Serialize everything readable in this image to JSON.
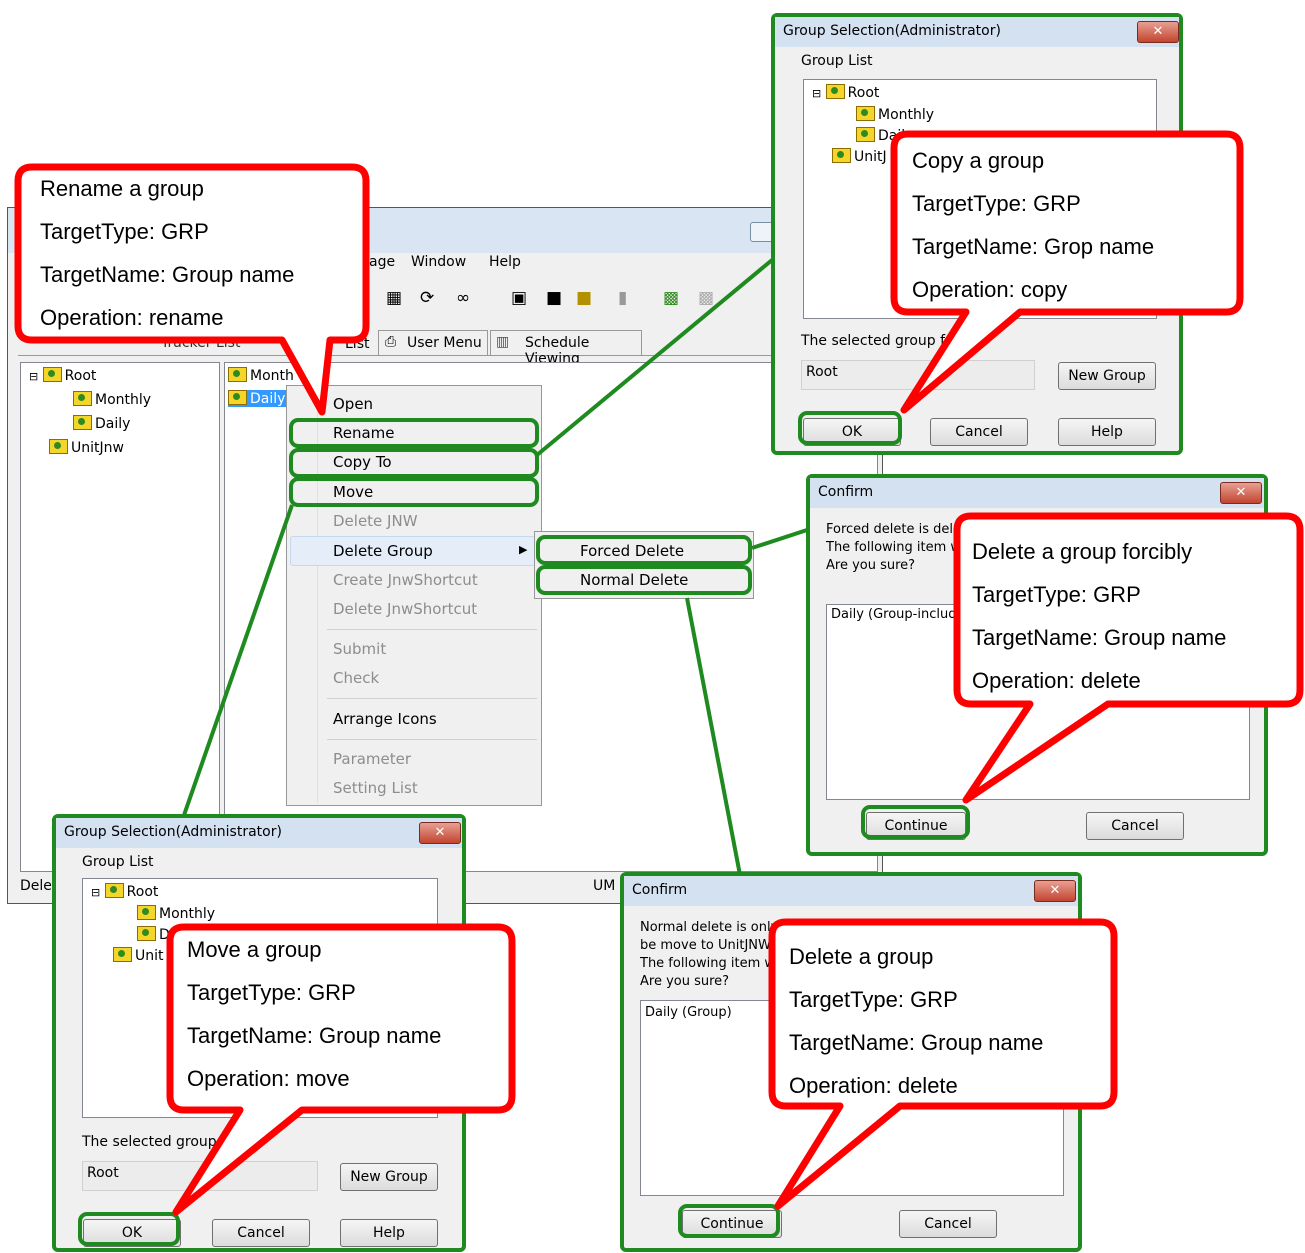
{
  "main_window": {
    "menubar": [
      "age",
      "Window",
      "Help"
    ],
    "tabs": [
      "Tracker List",
      "List",
      "User Menu",
      "Schedule Viewing"
    ],
    "tree": [
      "Root",
      "Monthly",
      "Daily",
      "UnitJnw"
    ],
    "list_items": [
      "Month",
      "Daily"
    ],
    "status_left": "Delet",
    "status_right": "UM"
  },
  "context_menu": {
    "items": [
      "Open",
      "Rename",
      "Copy To",
      "Move",
      "Delete JNW",
      "Delete Group",
      "Create JnwShortcut",
      "Delete JnwShortcut",
      "Submit",
      "Check",
      "Arrange Icons",
      "Parameter",
      "Setting List"
    ],
    "submenu": [
      "Forced Delete",
      "Normal Delete"
    ]
  },
  "group_dialog_top": {
    "title": "Group Selection(Administrator)",
    "close": "✕",
    "group_list_label": "Group List",
    "tree": [
      "Root",
      "Monthly",
      "Dail",
      "UnitJ"
    ],
    "selected_label": "The selected group ful",
    "selected_value": "Root",
    "new_group": "New Group",
    "ok": "OK",
    "cancel": "Cancel",
    "help": "Help"
  },
  "group_dialog_bottom": {
    "title": "Group Selection(Administrator)",
    "close": "✕",
    "group_list_label": "Group List",
    "tree": [
      "Root",
      "Monthly",
      "D",
      "Unit"
    ],
    "selected_label": "The selected group fu",
    "selected_value": "Root",
    "new_group": "New Group",
    "ok": "OK",
    "cancel": "Cancel",
    "help": "Help"
  },
  "confirm_forced": {
    "title": "Confirm",
    "close": "✕",
    "message": [
      "Forced delete is dele",
      "The following item w",
      "Are you sure?"
    ],
    "item": "Daily (Group-includi",
    "continue": "Continue",
    "cancel": "Cancel"
  },
  "confirm_normal": {
    "title": "Confirm",
    "close": "✕",
    "message": [
      "Normal delete is only",
      "be move to UnitJNW",
      "The following item w",
      "Are you sure?"
    ],
    "item": "Daily (Group)",
    "continue": "Continue",
    "cancel": "Cancel"
  },
  "callouts": {
    "rename": [
      "Rename a group",
      "TargetType: GRP",
      "TargetName: Group name",
      "Operation: rename"
    ],
    "copy": [
      "Copy a group",
      "TargetType: GRP",
      "TargetName: Grop name",
      "Operation: copy"
    ],
    "forced": [
      "Delete a group forcibly",
      "TargetType: GRP",
      "TargetName: Group name",
      "Operation: delete"
    ],
    "move": [
      "Move a group",
      "TargetType: GRP",
      "TargetName: Group name",
      "Operation: move"
    ],
    "normal": [
      "Delete a group",
      "TargetType: GRP",
      "TargetName: Group name",
      "Operation: delete"
    ]
  },
  "colors": {
    "callout_border": "#ff0000",
    "highlight_border": "#1f8a1f",
    "titlebar": "#d3e1f1"
  }
}
